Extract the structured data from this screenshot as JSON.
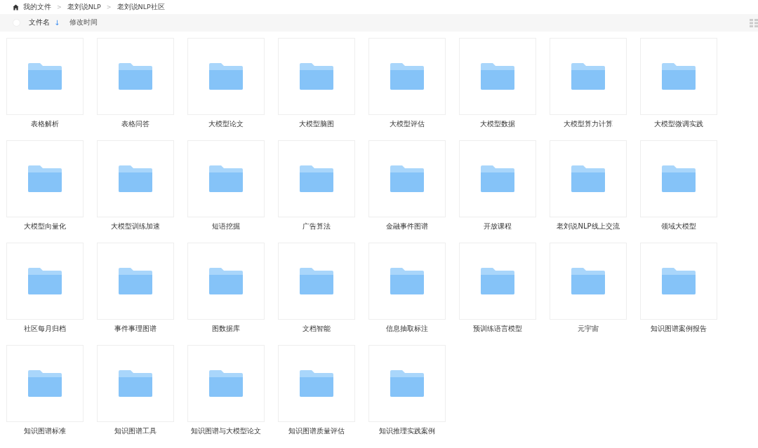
{
  "breadcrumb": [
    {
      "label": "我的文件",
      "kind": "home"
    },
    {
      "label": "老刘说NLP",
      "kind": "folder"
    },
    {
      "label": "老刘说NLP社区",
      "kind": "folder"
    }
  ],
  "breadcrumb_separator": ">",
  "header": {
    "select_all_checked": false,
    "columns": [
      {
        "label": "文件名",
        "sort_arrow": "↓",
        "selected": true
      },
      {
        "label": "修改时间",
        "selected": false
      }
    ]
  },
  "folders": [
    {
      "name": "表格解析"
    },
    {
      "name": "表格问答"
    },
    {
      "name": "大模型论文"
    },
    {
      "name": "大模型脑图"
    },
    {
      "name": "大模型评估"
    },
    {
      "name": "大模型数据"
    },
    {
      "name": "大模型算力计算"
    },
    {
      "name": "大模型微调实践"
    },
    {
      "name": "大模型向量化"
    },
    {
      "name": "大模型训练加速"
    },
    {
      "name": "短语挖掘"
    },
    {
      "name": "广告算法"
    },
    {
      "name": "金融事件图谱"
    },
    {
      "name": "开放课程"
    },
    {
      "name": "老刘说NLP线上交流"
    },
    {
      "name": "领域大模型"
    },
    {
      "name": "社区每月归档"
    },
    {
      "name": "事件事理图谱"
    },
    {
      "name": "图数据库"
    },
    {
      "name": "文档智能"
    },
    {
      "name": "信息抽取标注"
    },
    {
      "name": "预训练语言模型"
    },
    {
      "name": "元宇宙"
    },
    {
      "name": "知识图谱案例报告"
    },
    {
      "name": "知识图谱标准"
    },
    {
      "name": "知识图谱工具"
    },
    {
      "name": "知识图谱与大模型论文"
    },
    {
      "name": "知识图谱质量评估"
    },
    {
      "name": "知识推理实践案例"
    }
  ]
}
